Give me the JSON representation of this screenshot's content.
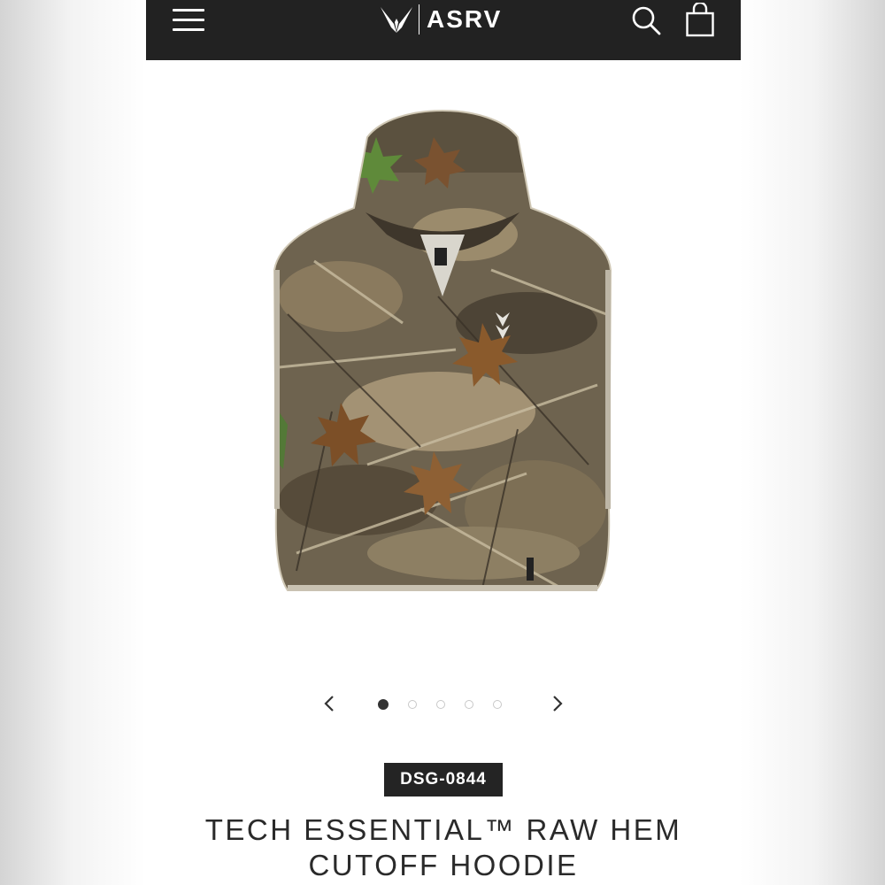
{
  "header": {
    "brand": "ASRV",
    "icons": {
      "menu": "hamburger-menu-icon",
      "search": "search-icon",
      "bag": "shopping-bag-icon"
    },
    "background": "#222222"
  },
  "gallery": {
    "image_alt": "camouflage sleeveless cutoff hoodie",
    "total_slides": 5,
    "active_index": 0,
    "prev_icon": "chevron-left-icon",
    "next_icon": "chevron-right-icon"
  },
  "product": {
    "sku": "DSG-0844",
    "title_line1": "TECH ESSENTIAL™ RAW HEM",
    "title_line2": "CUTOFF HOODIE"
  }
}
